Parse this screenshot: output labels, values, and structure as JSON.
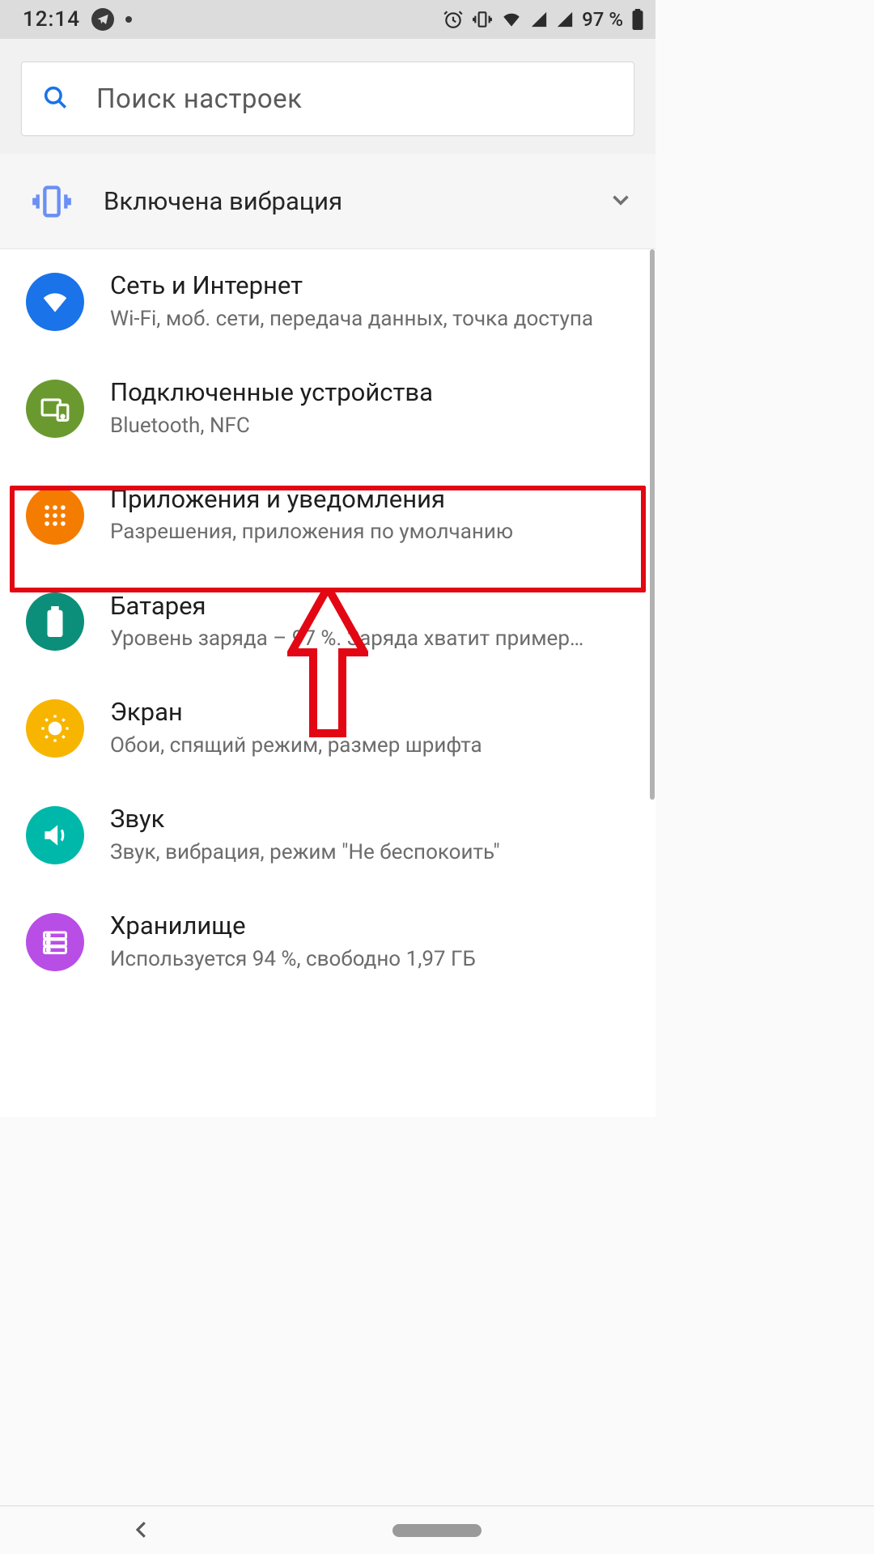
{
  "statusbar": {
    "time": "12:14",
    "battery_text": "97 %"
  },
  "search": {
    "placeholder": "Поиск настроек"
  },
  "vibrate": {
    "label": "Включена вибрация"
  },
  "settings": [
    {
      "title": "Сеть и Интернет",
      "subtitle": "Wi-Fi, моб. сети, передача данных, точка доступа",
      "icon_color": "#1a73e8"
    },
    {
      "title": "Подключенные устройства",
      "subtitle": "Bluetooth, NFC",
      "icon_color": "#6a9a2f"
    },
    {
      "title": "Приложения и уведомления",
      "subtitle": "Разрешения, приложения по умолчанию",
      "icon_color": "#f47c00",
      "highlighted": true
    },
    {
      "title": "Батарея",
      "subtitle": "Уровень заряда – 97 %. Заряда хватит пример…",
      "icon_color": "#0b8f7a"
    },
    {
      "title": "Экран",
      "subtitle": "Обои, спящий режим, размер шрифта",
      "icon_color": "#f7b500"
    },
    {
      "title": "Звук",
      "subtitle": "Звук, вибрация, режим \"Не беспокоить\"",
      "icon_color": "#00b8a9"
    },
    {
      "title": "Хранилище",
      "subtitle": "Используется 94 %, свободно 1,97 ГБ",
      "icon_color": "#b84ee6"
    }
  ],
  "annotation": {
    "highlight_color": "#e30613"
  }
}
